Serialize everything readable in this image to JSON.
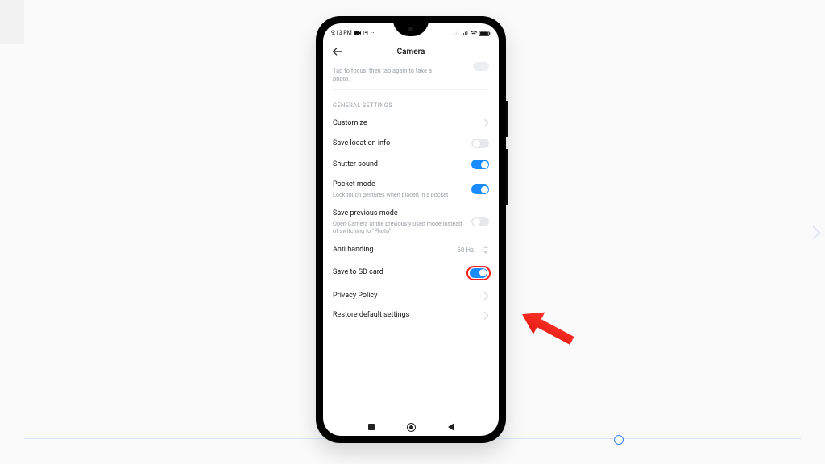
{
  "status": {
    "time": "9:13 PM",
    "recording_icon": "●",
    "more_icon": "⋯"
  },
  "header": {
    "title": "Camera"
  },
  "truncated": {
    "line1_visible": "Tap to focus, then tap again to take a",
    "line2": "photo."
  },
  "sections": {
    "general_label": "GENERAL SETTINGS"
  },
  "rows": {
    "customize": {
      "label": "Customize"
    },
    "save_location": {
      "label": "Save location info",
      "value": false
    },
    "shutter_sound": {
      "label": "Shutter sound",
      "value": true
    },
    "pocket_mode": {
      "label": "Pocket mode",
      "sub": "Lock touch gestures when placed in a pocket",
      "value": true
    },
    "save_previous": {
      "label": "Save previous mode",
      "sub": "Open Camera at the previously used mode instead of switching to \"Photo\"",
      "value": false
    },
    "anti_banding": {
      "label": "Anti banding",
      "value_label": "60 Hz"
    },
    "save_sd": {
      "label": "Save to SD card",
      "value": true
    },
    "privacy": {
      "label": "Privacy Policy"
    },
    "restore": {
      "label": "Restore default settings"
    }
  }
}
